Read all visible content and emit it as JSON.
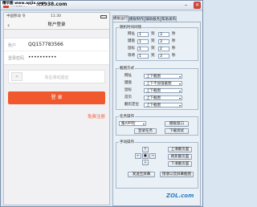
{
  "window": {
    "title": "微信登录",
    "watermark": "精华图 www.apjia.com",
    "watermark_site": ".cx938.com"
  },
  "phone": {
    "carrier": "中国移动 令",
    "time": "11:30",
    "nav_title": "账户登录",
    "back_glyph": "‹",
    "account_label": "账户",
    "account_value": "QQ157783566",
    "password_label": "登录密码",
    "password_value": "••••••••••",
    "captcha_text": "向右滑动验证",
    "login_label": "登 录",
    "register_label": "免费注册"
  },
  "panel": {
    "tabs": [
      "模板运行",
      "模板制作",
      "辅助服务",
      "帮助发布"
    ],
    "random_group": {
      "label": "随机时间间隔",
      "rows": [
        {
          "label": "网址",
          "from": "1",
          "to": "3",
          "unit": "秒"
        },
        {
          "label": "键盘",
          "from": "1",
          "to": "3",
          "unit": "秒"
        },
        {
          "label": "鼠标",
          "from": "1",
          "to": "2",
          "unit": "秒"
        },
        {
          "label": "等待",
          "from": "1",
          "to": "3",
          "unit": "秒"
        }
      ],
      "separator": "到"
    },
    "mode_group": {
      "label": "截图方式",
      "rows": [
        {
          "label": "网址",
          "value": "上下截图"
        },
        {
          "label": "键盘",
          "value": "上下不加强截图"
        },
        {
          "label": "鼠标",
          "value": "上下截图"
        },
        {
          "label": "首页",
          "value": "上下截图"
        },
        {
          "label": "翻页定位",
          "value": "上下截图"
        }
      ]
    },
    "task_group": {
      "label": "任务操作",
      "select_label": "集APP检",
      "btn_right_top": "模板窗口",
      "btn_left": "登录任务",
      "btn_right": "下载调试"
    },
    "manual_group": {
      "label": "手动操作",
      "up": "↑",
      "left": "←",
      "ok": "●",
      "right": "→",
      "down": "↓",
      "btn1": "上滑翻页面",
      "btn2": "刷新翻页面",
      "btn3": "下滑翻页面",
      "btn4": "发送至屏幕",
      "btn5": "接收以及屏幕截图"
    }
  },
  "logo": "ZOL.com"
}
